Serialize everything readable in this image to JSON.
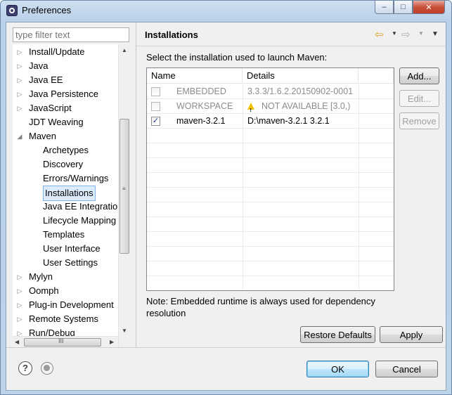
{
  "window": {
    "title": "Preferences",
    "minimize_glyph": "–",
    "maximize_glyph": "□",
    "close_glyph": "✕"
  },
  "sidebar": {
    "filter_placeholder": "type filter text",
    "tree": [
      {
        "label": "Install/Update",
        "level": 0,
        "arrow": "▷"
      },
      {
        "label": "Java",
        "level": 0,
        "arrow": "▷"
      },
      {
        "label": "Java EE",
        "level": 0,
        "arrow": "▷"
      },
      {
        "label": "Java Persistence",
        "level": 0,
        "arrow": "▷"
      },
      {
        "label": "JavaScript",
        "level": 0,
        "arrow": "▷"
      },
      {
        "label": "JDT Weaving",
        "level": 0,
        "arrow": ""
      },
      {
        "label": "Maven",
        "level": 0,
        "arrow": "◢"
      },
      {
        "label": "Archetypes",
        "level": 1,
        "arrow": ""
      },
      {
        "label": "Discovery",
        "level": 1,
        "arrow": ""
      },
      {
        "label": "Errors/Warnings",
        "level": 1,
        "arrow": ""
      },
      {
        "label": "Installations",
        "level": 1,
        "arrow": "",
        "selected": true
      },
      {
        "label": "Java EE Integration",
        "level": 1,
        "arrow": ""
      },
      {
        "label": "Lifecycle Mapping",
        "level": 1,
        "arrow": ""
      },
      {
        "label": "Templates",
        "level": 1,
        "arrow": ""
      },
      {
        "label": "User Interface",
        "level": 1,
        "arrow": ""
      },
      {
        "label": "User Settings",
        "level": 1,
        "arrow": ""
      },
      {
        "label": "Mylyn",
        "level": 0,
        "arrow": "▷"
      },
      {
        "label": "Oomph",
        "level": 0,
        "arrow": "▷"
      },
      {
        "label": "Plug-in Development",
        "level": 0,
        "arrow": "▷"
      },
      {
        "label": "Remote Systems",
        "level": 0,
        "arrow": "▷"
      },
      {
        "label": "Run/Debug",
        "level": 0,
        "arrow": "▷"
      }
    ],
    "hscroll_grip": "III"
  },
  "page": {
    "title": "Installations",
    "description": "Select the installation used to launch Maven:",
    "table": {
      "columns": [
        "Name",
        "Details"
      ],
      "rows": [
        {
          "checked": false,
          "disabled": true,
          "name": "EMBEDDED",
          "details": "3.3.3/1.6.2.20150902-0001",
          "warning": false
        },
        {
          "checked": false,
          "disabled": true,
          "name": "WORKSPACE",
          "details": "NOT AVAILABLE [3.0,)",
          "warning": true
        },
        {
          "checked": true,
          "disabled": false,
          "name": "maven-3.2.1",
          "details": "D:\\maven-3.2.1 3.2.1",
          "warning": false
        }
      ],
      "check_glyph": "✓"
    },
    "buttons": {
      "add": "Add...",
      "edit": "Edit...",
      "remove": "Remove",
      "restore_defaults": "Restore Defaults",
      "apply": "Apply"
    },
    "note": "Note: Embedded runtime is always used for dependency resolution"
  },
  "footer": {
    "help_glyph": "?",
    "ok": "OK",
    "cancel": "Cancel"
  },
  "colors": {
    "selection_bg": "#dcecfc",
    "selection_border": "#7eb4ea",
    "warning": "#f2c200",
    "title_bar": "#b9d1ea"
  }
}
